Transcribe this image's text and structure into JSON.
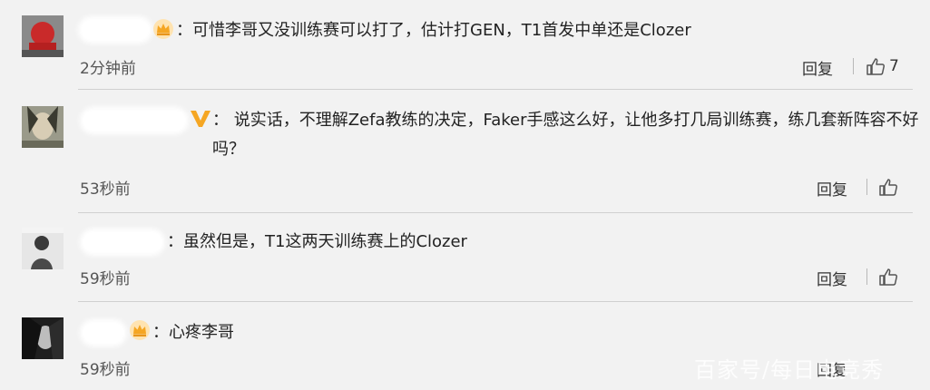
{
  "comments": [
    {
      "text": "：可惜李哥又没训练赛可以打了，估计打GEN，T1首发中单还是Clozer",
      "time": "2分钟前",
      "reply_label": "回复",
      "like_count": "7",
      "badge": "crown-icon"
    },
    {
      "text": "：  说实话，不理解Zefa教练的决定，Faker手感这么好，让他多打几局训练赛，练几套新阵容不好吗？",
      "time": "53秒前",
      "reply_label": "回复",
      "badge": "v-verified-icon"
    },
    {
      "text": "：虽然但是，T1这两天训练赛上的Clozer",
      "time": "59秒前",
      "reply_label": "回复"
    },
    {
      "text": "：心疼李哥",
      "time": "59秒前",
      "reply_label": "回复",
      "badge": "crown-icon"
    }
  ],
  "watermark": "百家号/每日电竞秀",
  "colors": {
    "background": "#f2f2f2",
    "divider": "#d0d0d0",
    "crown": "#f5a623",
    "v_badge": "#f5a623"
  }
}
